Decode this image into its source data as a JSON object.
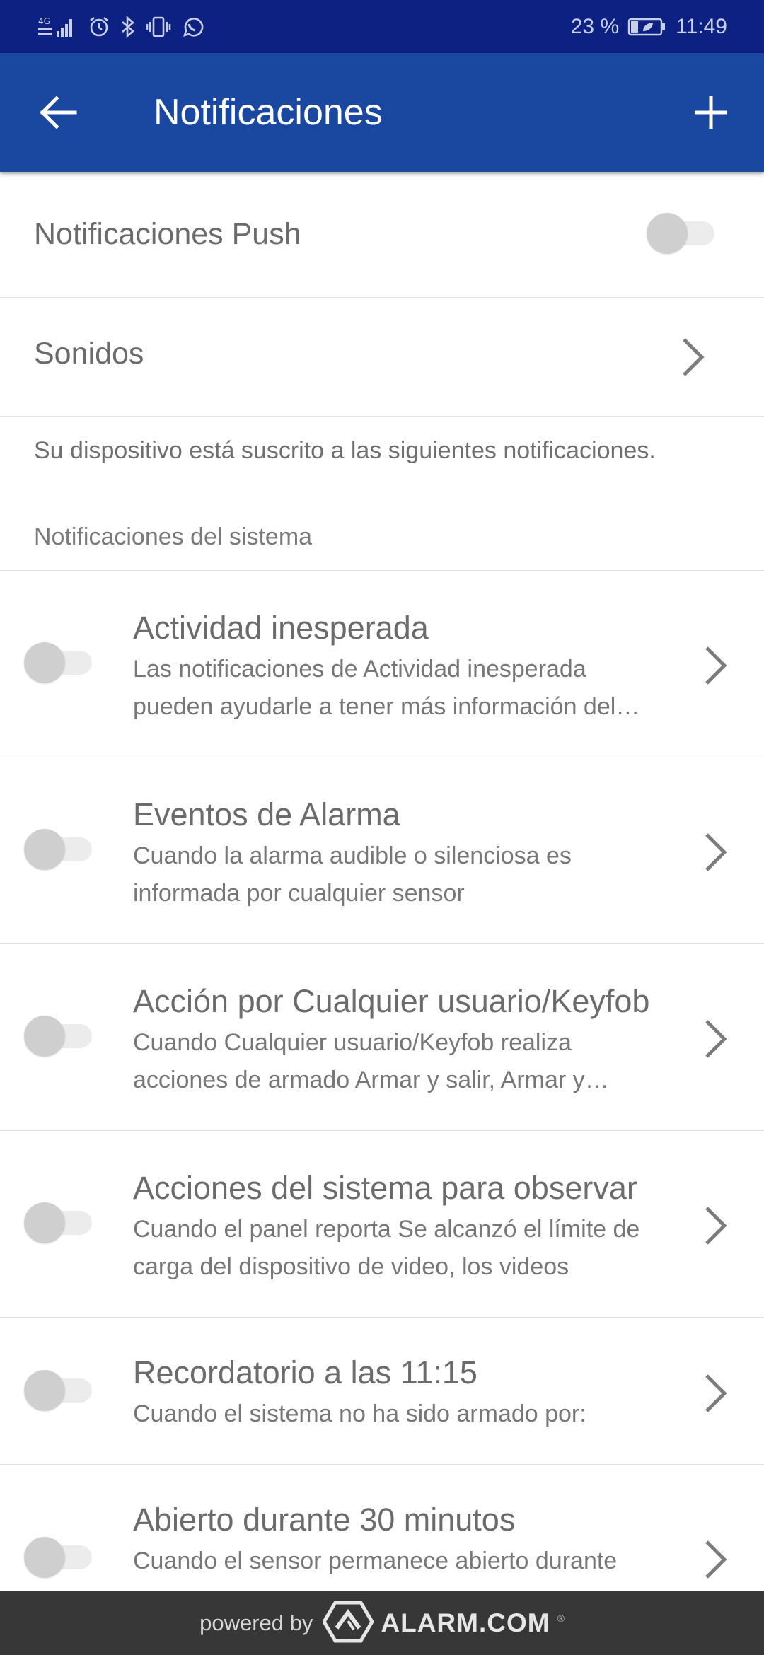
{
  "status_bar": {
    "network_label": "4G",
    "battery_text": "23 %",
    "time": "11:49",
    "icons": [
      "signal-icon",
      "alarm-clock-icon",
      "bluetooth-icon",
      "vibrate-icon",
      "whatsapp-icon",
      "battery-icon"
    ]
  },
  "app_bar": {
    "title": "Notificaciones",
    "background_color": "#1a47a0",
    "status_color": "#0d2183"
  },
  "push": {
    "label": "Notificaciones Push",
    "enabled": false
  },
  "sounds": {
    "label": "Sonidos"
  },
  "info_text": "Su dispositivo está suscrito a las siguientes notificaciones.",
  "section_header": "Notificaciones del sistema",
  "notifications": [
    {
      "title": "Actividad inesperada",
      "description": "Las notificaciones de Actividad inesperada pueden ayudarle a tener más información del comportamiento de su sistema",
      "enabled": false
    },
    {
      "title": "Eventos de Alarma",
      "description": "Cuando la alarma audible o silenciosa es informada por cualquier sensor",
      "enabled": false
    },
    {
      "title": "Acción por Cualquier usuario/Keyfob",
      "description": "Cuando Cualquier usuario/Keyfob realiza acciones de armado Armar y salir, Armar y quedarse",
      "enabled": false
    },
    {
      "title": "Acciones del sistema para observar",
      "description": "Cuando el panel reporta Se alcanzó el límite de carga del dispositivo de video, los videos",
      "enabled": false
    },
    {
      "title": "Recordatorio a las 11:15",
      "description": "Cuando el sistema no ha sido armado por:",
      "enabled": false
    },
    {
      "title": "Abierto durante 30 minutos",
      "description": "Cuando el sensor permanece abierto durante",
      "enabled": false
    }
  ],
  "footer": {
    "powered_by": "powered by",
    "brand": "ALARM.COM",
    "registered": "®"
  }
}
